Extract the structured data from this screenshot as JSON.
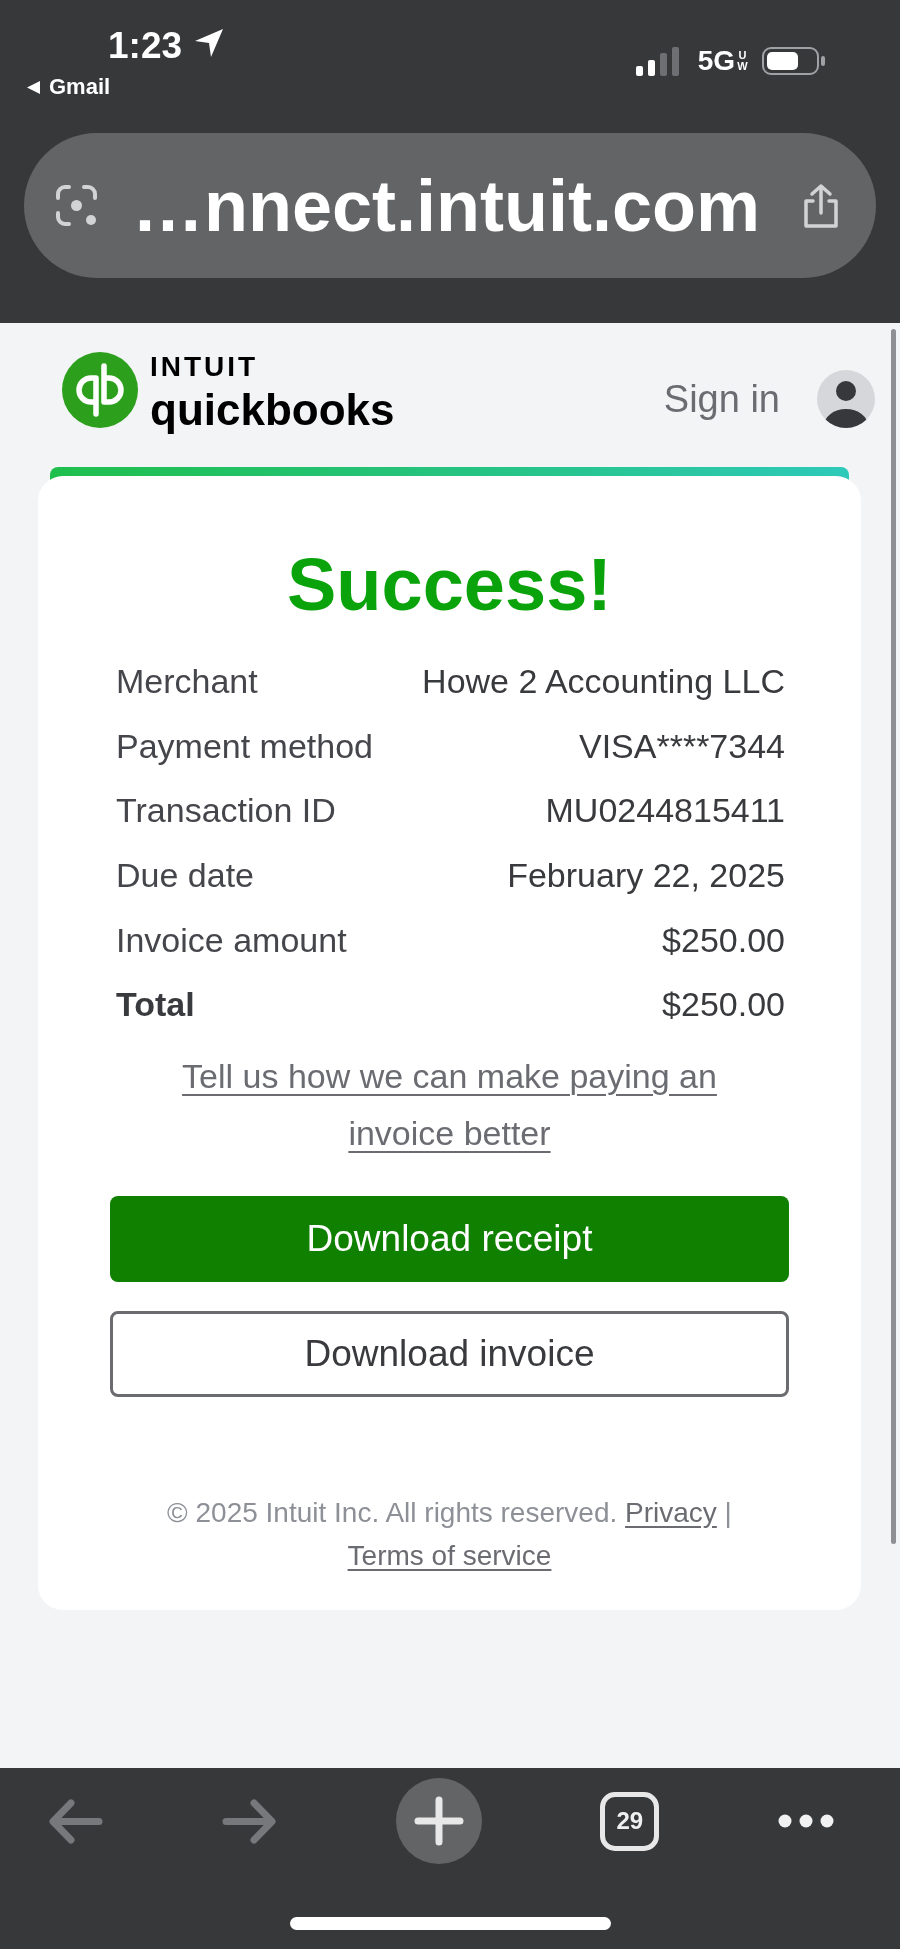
{
  "status_bar": {
    "time": "1:23",
    "back_label": "Gmail",
    "network": "5G",
    "network_badge": "UW"
  },
  "address_bar": {
    "url": "…nnect.intuit.com"
  },
  "header": {
    "brand": "INTUIT",
    "product": "quickbooks",
    "sign_in": "Sign in"
  },
  "card": {
    "title": "Success!",
    "details": [
      {
        "label": "Merchant",
        "value": "Howe 2 Accounting LLC",
        "emphasized": false
      },
      {
        "label": "Payment method",
        "value": "VISA****7344",
        "emphasized": false
      },
      {
        "label": "Transaction ID",
        "value": "MU0244815411",
        "emphasized": false
      },
      {
        "label": "Due date",
        "value": "February 22, 2025",
        "emphasized": false
      },
      {
        "label": "Invoice amount",
        "value": "$250.00",
        "emphasized": false
      },
      {
        "label": "Total",
        "value": "$250.00",
        "emphasized": true
      }
    ],
    "feedback_link": "Tell us how we can make paying an invoice better",
    "buttons": [
      {
        "label": "Download receipt",
        "kind": "primary"
      },
      {
        "label": "Download invoice",
        "kind": "secondary"
      }
    ],
    "footer": {
      "copyright": "© 2025 Intuit Inc. All rights reserved.",
      "links": [
        "Privacy",
        "Terms of service"
      ],
      "separator": "|"
    }
  },
  "toolbar": {
    "back_disabled": true,
    "forward_disabled": true,
    "tab_count": "29"
  }
}
